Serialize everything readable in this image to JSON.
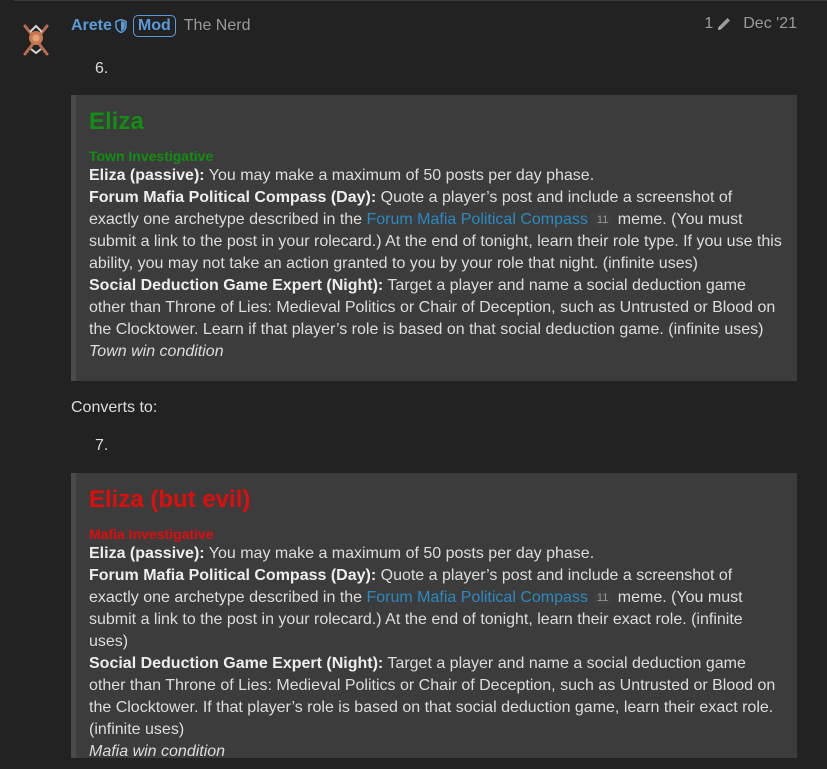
{
  "post": {
    "username": "Arete",
    "badge": "Mod",
    "user_title": "The Nerd",
    "edit_count": "1",
    "date": "Dec '21"
  },
  "items": [
    {
      "number": "6.",
      "role_name": "Eliza",
      "role_color": "#138d13",
      "alignment": "Town Investigative",
      "abilities": [
        {
          "name": "Eliza (passive):",
          "text": " You may make a maximum of 50 posts per day phase."
        },
        {
          "name": "Forum Mafia Political Compass (Day):",
          "text_before": " Quote a player’s post and include a screenshot of exactly one archetype described in the ",
          "link": "Forum Mafia Political Compass",
          "clicks": "11",
          "text_after": " meme. (You must submit a link to the post in your rolecard.) At the end of tonight, learn their role type. If you use this ability, you may not take an action granted to you by your role that night. (infinite uses)"
        },
        {
          "name": "Social Deduction Game Expert (Night):",
          "text": " Target a player and name a social deduction game other than Throne of Lies: Medieval Politics or Chair of Deception, such as Untrusted or Blood on the Clocktower. Learn if that player’s role is based on that social deduction game. (infinite uses)"
        }
      ],
      "win_condition": "Town win condition"
    },
    {
      "number": "7.",
      "role_name": "Eliza (but evil)",
      "role_color": "#e00d0d",
      "alignment": "Mafia Investigative",
      "abilities": [
        {
          "name": "Eliza (passive):",
          "text": " You may make a maximum of 50 posts per day phase."
        },
        {
          "name": "Forum Mafia Political Compass (Day):",
          "text_before": " Quote a player’s post and include a screenshot of exactly one archetype described in the ",
          "link": "Forum Mafia Political Compass",
          "clicks": "11",
          "text_after": " meme. (You must submit a link to the post in your rolecard.) At the end of tonight, learn their exact role. (infinite uses)"
        },
        {
          "name": "Social Deduction Game Expert (Night):",
          "text": " Target a player and name a social deduction game other than Throne of Lies: Medieval Politics or Chair of Deception, such as Untrusted or Blood on the Clocktower. If that player’s role is based on that social deduction game, learn their exact role. (infinite uses)"
        }
      ],
      "win_condition": "Mafia win condition"
    }
  ],
  "converts_text": "Converts to:",
  "colors": {
    "background": "#222222",
    "quote_bg": "#3c3c3c",
    "username": "#5a9bd8",
    "link": "#2b8ac0"
  },
  "icons": {
    "avatar": "avatar-emblem",
    "shield": "shield-icon",
    "edit": "pencil-icon"
  }
}
